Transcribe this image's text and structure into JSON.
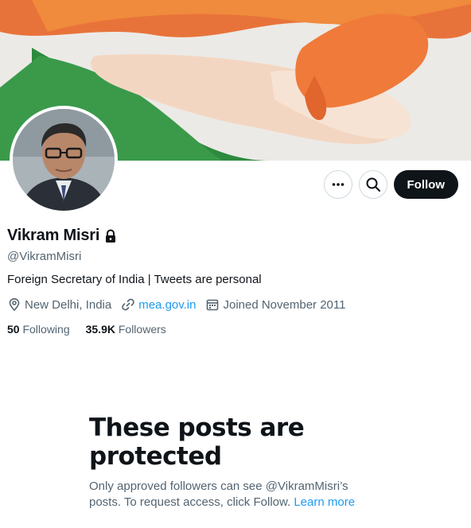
{
  "profile": {
    "display_name": "Vikram Misri",
    "handle": "@VikramMisri",
    "bio": "Foreign Secretary of India | Tweets are personal",
    "location": "New Delhi, India",
    "website": "mea.gov.in",
    "joined": "Joined November 2011",
    "following_count": "50",
    "following_label": "Following",
    "followers_count": "35.9K",
    "followers_label": "Followers"
  },
  "actions": {
    "more_icon": "more-icon",
    "search_icon": "search-icon",
    "follow_label": "Follow"
  },
  "protected": {
    "title": "These posts are protected",
    "body": "Only approved followers can see @VikramMisri’s posts. To request access, click Follow.",
    "learn_more": "Learn more"
  },
  "colors": {
    "accent": "#1d9bf0",
    "text": "#0f1419",
    "muted": "#536471",
    "follow_bg": "#0f1419"
  }
}
